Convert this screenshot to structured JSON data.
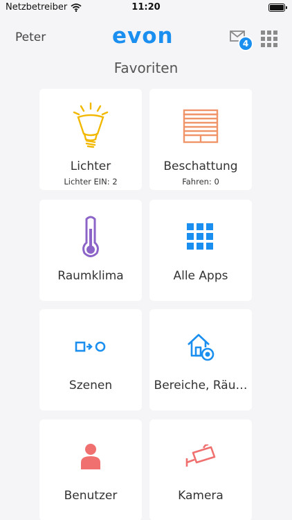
{
  "status_bar": {
    "carrier": "Netzbetreiber",
    "time": "11:20",
    "battery_level": 1.0
  },
  "header": {
    "user": "Peter",
    "logo_text": "evon",
    "messages_count": "4"
  },
  "page_title": "Favoriten",
  "tiles": [
    {
      "label": "Lichter",
      "sub": "Lichter EIN: 2",
      "icon": "light-bulb-icon",
      "color": "#f2b800"
    },
    {
      "label": "Beschattung",
      "sub": "Fahren: 0",
      "icon": "blinds-icon",
      "color": "#f0956a"
    },
    {
      "label": "Raumklima",
      "icon": "thermometer-icon",
      "color": "#8c64c8"
    },
    {
      "label": "Alle Apps",
      "icon": "apps-grid-icon",
      "color": "#1a8ff0"
    },
    {
      "label": "Szenen",
      "icon": "scene-icon",
      "color": "#1a8ff0"
    },
    {
      "label": "Bereiche, Räu…",
      "icon": "home-area-icon",
      "color": "#1a8ff0"
    },
    {
      "label": "Benutzer",
      "icon": "user-icon",
      "color": "#f07070"
    },
    {
      "label": "Kamera",
      "icon": "camera-icon",
      "color": "#f07070"
    }
  ]
}
